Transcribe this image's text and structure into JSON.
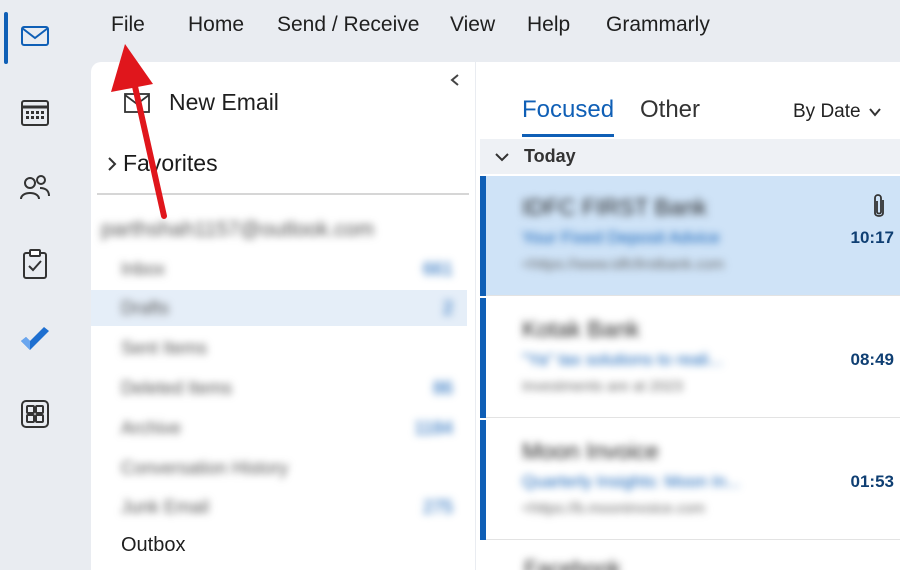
{
  "menu": {
    "file": "File",
    "home": "Home",
    "send_receive": "Send / Receive",
    "view": "View",
    "help": "Help",
    "grammarly": "Grammarly"
  },
  "rail": {
    "icons": [
      "mail-icon",
      "calendar-icon",
      "people-icon",
      "clipboard-check-icon",
      "todo-check-icon",
      "apps-grid-icon"
    ]
  },
  "folders": {
    "new_email": "New Email",
    "favorites": "Favorites",
    "account": "parthshah1157@outlook.com",
    "items": [
      {
        "name": "Inbox",
        "count": "661"
      },
      {
        "name": "Drafts",
        "count": "2"
      },
      {
        "name": "Sent Items",
        "count": ""
      },
      {
        "name": "Deleted Items",
        "count": "86"
      },
      {
        "name": "Archive",
        "count": "1184"
      },
      {
        "name": "Conversation History",
        "count": ""
      },
      {
        "name": "Junk Email",
        "count": "275"
      }
    ],
    "outbox": "Outbox"
  },
  "list": {
    "tab_focused": "Focused",
    "tab_other": "Other",
    "sort_label": "By Date",
    "group_label": "Today",
    "messages": [
      {
        "sender": "IDFC FIRST Bank",
        "subject": "Your Fixed Deposit Advice",
        "preview": "<https://www.idfcfirstbank.com",
        "time": "10:17"
      },
      {
        "sender": "Kotak Bank",
        "subject": "\"Ya\" tax solutions to reali...",
        "preview": "Investments are at 2023",
        "time": "08:49"
      },
      {
        "sender": "Moon Invoice",
        "subject": "Quarterly Insights: Moon In...",
        "preview": "<https://b.mooninvoice.com",
        "time": "01:53"
      }
    ],
    "next_sender": "Facebook"
  },
  "colors": {
    "accent": "#0f5fb6",
    "selected_row": "#cfe3f7",
    "annotation_arrow": "#e0161c"
  }
}
